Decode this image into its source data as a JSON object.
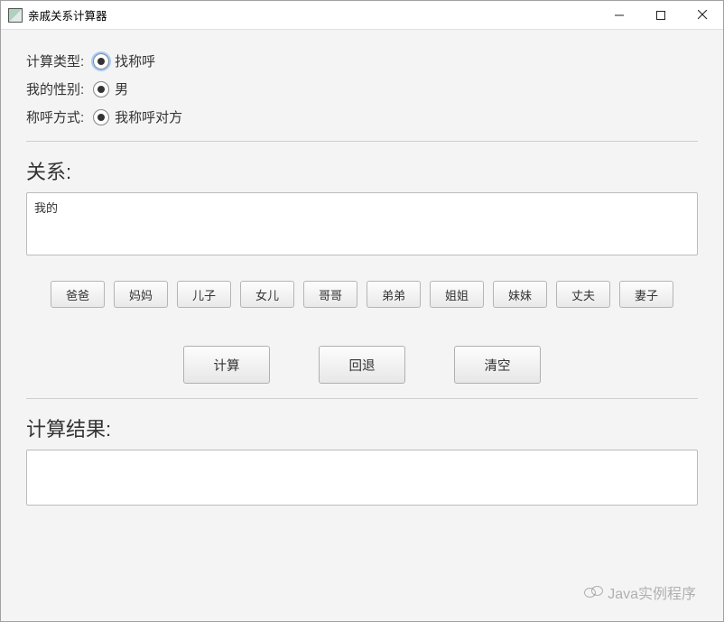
{
  "window": {
    "title": "亲戚关系计算器"
  },
  "form": {
    "calc_type_label": "计算类型:",
    "calc_type_value": "找称呼",
    "gender_label": "我的性别:",
    "gender_value": "男",
    "call_mode_label": "称呼方式:",
    "call_mode_value": "我称呼对方"
  },
  "relation": {
    "heading": "关系:",
    "value": "我的",
    "buttons": [
      "爸爸",
      "妈妈",
      "儿子",
      "女儿",
      "哥哥",
      "弟弟",
      "姐姐",
      "妹妹",
      "丈夫",
      "妻子"
    ]
  },
  "actions": {
    "compute": "计算",
    "back": "回退",
    "clear": "清空"
  },
  "result": {
    "heading": "计算结果:",
    "value": ""
  },
  "watermark": "Java实例程序"
}
